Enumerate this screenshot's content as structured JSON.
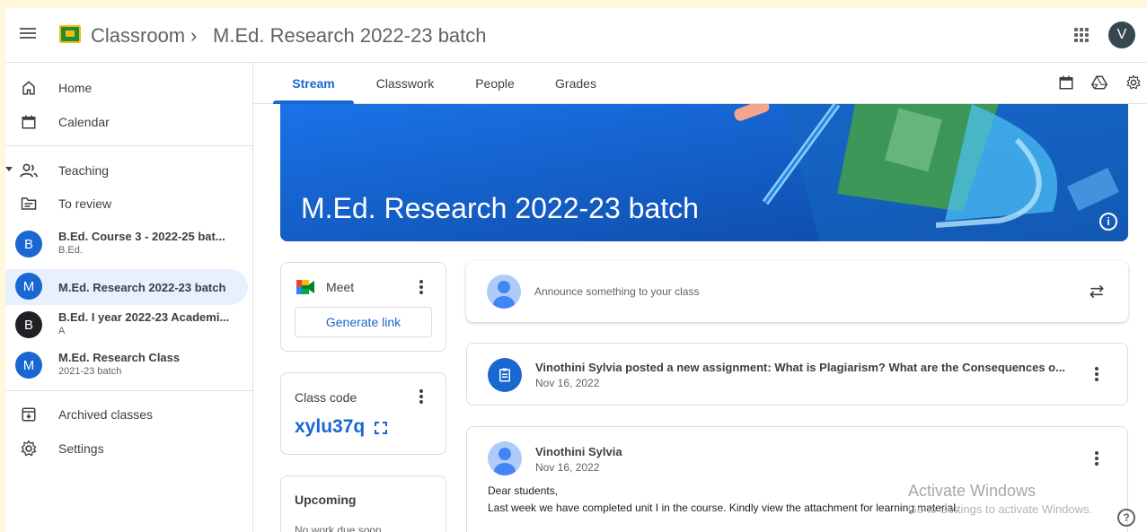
{
  "header": {
    "app_title": "Classroom",
    "separator": "›",
    "class_title": "M.Ed. Research 2022-23 batch",
    "avatar_letter": "V"
  },
  "sidebar": {
    "home": "Home",
    "calendar": "Calendar",
    "teaching": "Teaching",
    "to_review": "To review",
    "classes": [
      {
        "letter": "B",
        "name": "B.Ed. Course 3 - 2022-25 bat...",
        "sub": "B.Ed.",
        "color": "#1967d2"
      },
      {
        "letter": "M",
        "name": "M.Ed. Research 2022-23 batch",
        "sub": "",
        "color": "#1967d2"
      },
      {
        "letter": "B",
        "name": "B.Ed. I year 2022-23 Academi...",
        "sub": "A",
        "color": "#202124"
      },
      {
        "letter": "M",
        "name": "M.Ed. Research Class",
        "sub": "2021-23 batch",
        "color": "#1967d2"
      }
    ],
    "archived": "Archived classes",
    "settings": "Settings"
  },
  "tabs": [
    "Stream",
    "Classwork",
    "People",
    "Grades"
  ],
  "banner": {
    "title": "M.Ed. Research 2022-23 batch",
    "info": "i"
  },
  "meet": {
    "title": "Meet",
    "button": "Generate link"
  },
  "class_code": {
    "label": "Class code",
    "value": "xylu37q"
  },
  "upcoming": {
    "title": "Upcoming",
    "text": "No work due soon"
  },
  "announce": {
    "placeholder": "Announce something to your class"
  },
  "posts": [
    {
      "title": "Vinothini Sylvia posted a new assignment: What is Plagiarism? What are the Consequences o...",
      "date": "Nov 16, 2022"
    },
    {
      "title": "Vinothini Sylvia",
      "date": "Nov 16, 2022",
      "body1": "Dear students,",
      "body2": "Last week we have completed unit I in the course. Kindly view the attachment for learning material."
    }
  ],
  "watermark": {
    "line1": "Activate Windows",
    "line2": "Go to Settings to activate Windows."
  },
  "help": "?",
  "colors": {
    "accent": "#1967d2",
    "banner": "#1a73e8",
    "active_nav": "#e8f0fe"
  }
}
